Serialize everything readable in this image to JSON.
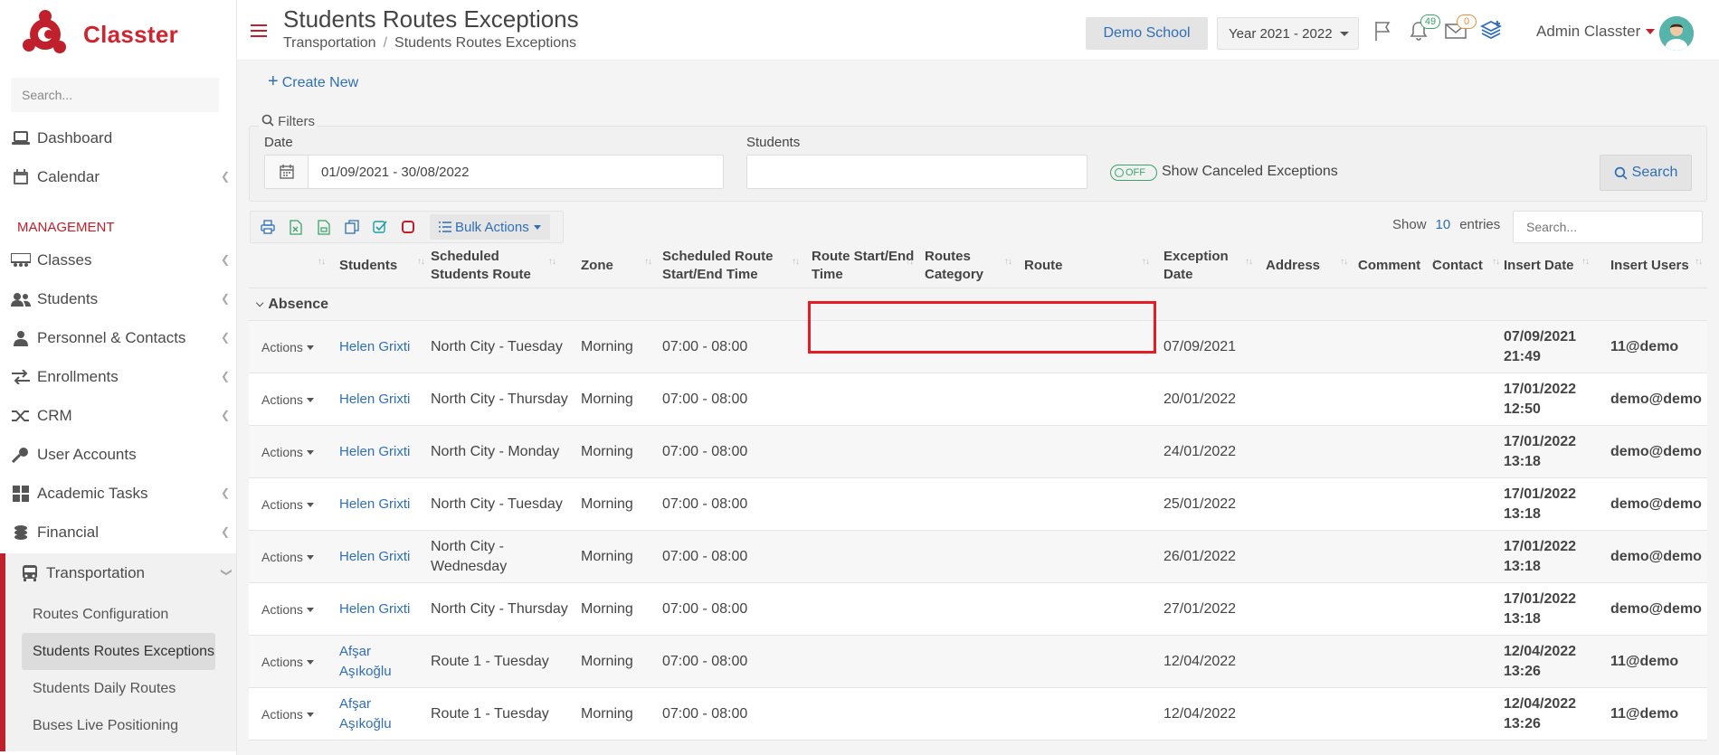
{
  "brand": {
    "name": "Classter"
  },
  "sidebar": {
    "search_placeholder": "Search...",
    "items": [
      {
        "label": "Dashboard"
      },
      {
        "label": "Calendar"
      }
    ],
    "section_label": "MANAGEMENT",
    "management": [
      {
        "label": "Classes"
      },
      {
        "label": "Students"
      },
      {
        "label": "Personnel & Contacts"
      },
      {
        "label": "Enrollments"
      },
      {
        "label": "CRM"
      },
      {
        "label": "User Accounts"
      },
      {
        "label": "Academic Tasks"
      },
      {
        "label": "Financial"
      },
      {
        "label": "Transportation"
      }
    ],
    "sub_items": [
      {
        "label": "Routes Configuration"
      },
      {
        "label": "Students Routes Exceptions"
      },
      {
        "label": "Students Daily Routes"
      },
      {
        "label": "Buses Live Positioning"
      }
    ]
  },
  "header": {
    "title": "Students Routes Exceptions",
    "breadcrumb": [
      "Transportation",
      "Students Routes Exceptions"
    ],
    "school": "Demo School",
    "year": "Year 2021 - 2022",
    "notifications_count": "49",
    "messages_count": "0",
    "user": "Admin Classter"
  },
  "toolbar": {
    "create_label": "Create New",
    "filters_label": "Filters",
    "date_label": "Date",
    "date_value": "01/09/2021 - 30/08/2022",
    "students_label": "Students",
    "toggle_label": "OFF",
    "show_canceled_label": "Show Canceled Exceptions",
    "search_label": "Search",
    "bulk_label": "Bulk Actions",
    "show_label": "Show",
    "entries_count": "10",
    "entries_label": "entries",
    "table_search_placeholder": "Search..."
  },
  "table": {
    "columns": [
      "",
      "Students",
      "Scheduled Students Route",
      "Zone",
      "Scheduled Route Start/End Time",
      "Route Start/End Time",
      "Routes Category",
      "Route",
      "Exception Date",
      "Address",
      "Comment",
      "Contact",
      "Insert Date",
      "Insert Users"
    ],
    "group_label": "Absence",
    "action_label": "Actions",
    "rows": [
      {
        "student": "Helen Grixti",
        "sched_route": "North City - Tuesday",
        "zone": "Morning",
        "sched_time": "07:00 - 08:00",
        "exception_date": "07/09/2021",
        "insert_date": "07/09/2021 21:49",
        "insert_user": "11@demo"
      },
      {
        "student": "Helen Grixti",
        "sched_route": "North City - Thursday",
        "zone": "Morning",
        "sched_time": "07:00 - 08:00",
        "exception_date": "20/01/2022",
        "insert_date": "17/01/2022 12:50",
        "insert_user": "demo@demo"
      },
      {
        "student": "Helen Grixti",
        "sched_route": "North City - Monday",
        "zone": "Morning",
        "sched_time": "07:00 - 08:00",
        "exception_date": "24/01/2022",
        "insert_date": "17/01/2022 13:18",
        "insert_user": "demo@demo"
      },
      {
        "student": "Helen Grixti",
        "sched_route": "North City - Tuesday",
        "zone": "Morning",
        "sched_time": "07:00 - 08:00",
        "exception_date": "25/01/2022",
        "insert_date": "17/01/2022 13:18",
        "insert_user": "demo@demo"
      },
      {
        "student": "Helen Grixti",
        "sched_route": "North City - Wednesday",
        "zone": "Morning",
        "sched_time": "07:00 - 08:00",
        "exception_date": "26/01/2022",
        "insert_date": "17/01/2022 13:18",
        "insert_user": "demo@demo"
      },
      {
        "student": "Helen Grixti",
        "sched_route": "North City - Thursday",
        "zone": "Morning",
        "sched_time": "07:00 - 08:00",
        "exception_date": "27/01/2022",
        "insert_date": "17/01/2022 13:18",
        "insert_user": "demo@demo"
      },
      {
        "student": "Afşar Aşıkoğlu",
        "sched_route": "Route 1 - Tuesday",
        "zone": "Morning",
        "sched_time": "07:00 - 08:00",
        "exception_date": "12/04/2022",
        "insert_date": "12/04/2022 13:26",
        "insert_user": "11@demo"
      },
      {
        "student": "Afşar Aşıkoğlu",
        "sched_route": "Route 1 - Tuesday",
        "zone": "Morning",
        "sched_time": "07:00 - 08:00",
        "exception_date": "12/04/2022",
        "insert_date": "12/04/2022 13:26",
        "insert_user": "11@demo"
      }
    ]
  },
  "colors": {
    "brand_red": "#c0202c",
    "link_blue": "#2f6fb5",
    "highlight_red": "#e41c24"
  }
}
